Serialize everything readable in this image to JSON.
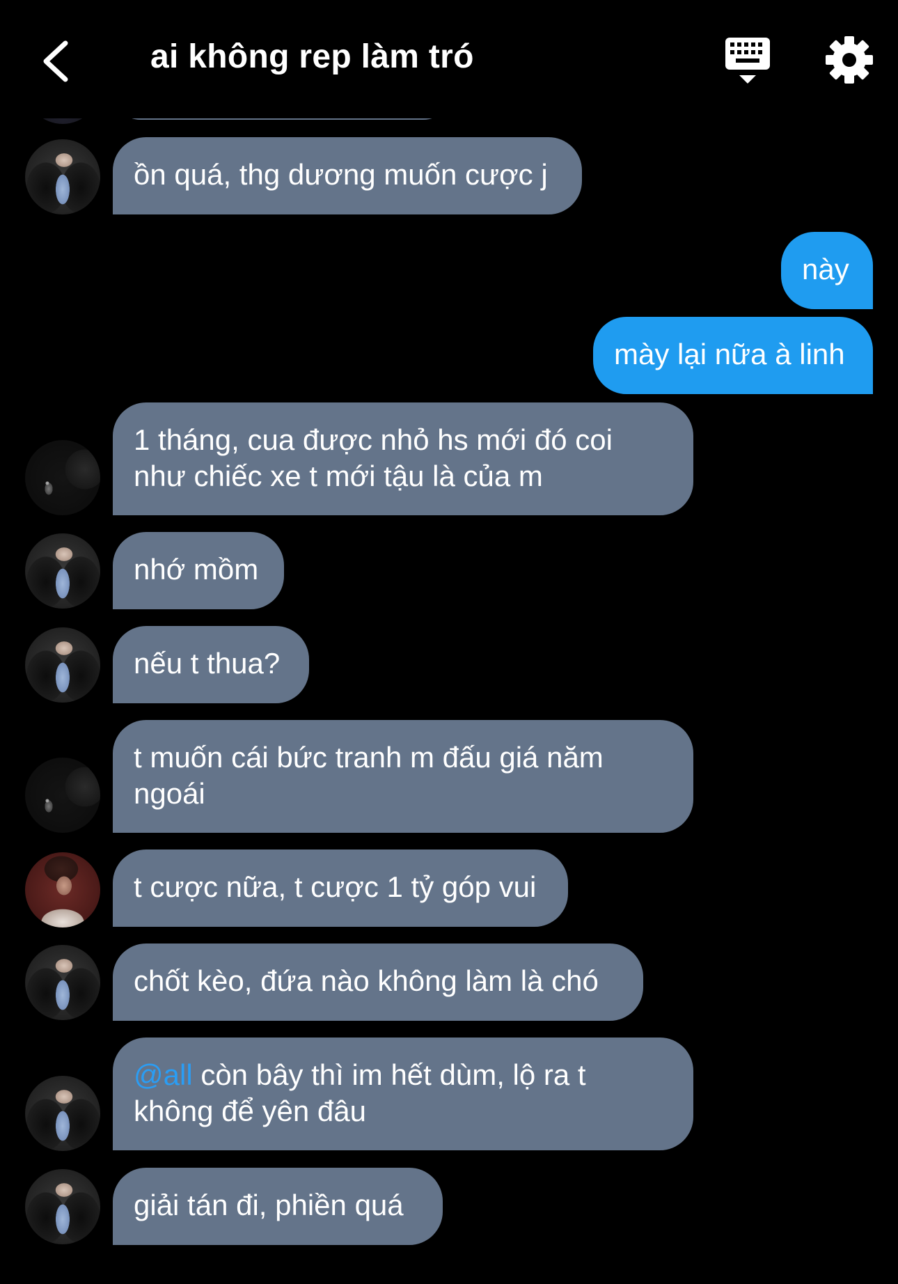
{
  "header": {
    "title": "ai không rep làm tró",
    "back_icon": "chevron-left-icon",
    "keyboard_icon": "keyboard-icon",
    "settings_icon": "gear-icon"
  },
  "colors": {
    "background": "#000000",
    "incoming_bubble": "#64748a",
    "outgoing_bubble": "#1f9cf0",
    "mention": "#2a9df4"
  },
  "messages": [
    {
      "direction": "in",
      "avatar": "girl",
      "lines": [
        "ồn quá, thg dương muốn cược j"
      ]
    },
    {
      "direction": "out",
      "lines": [
        "này"
      ]
    },
    {
      "direction": "out",
      "lines": [
        "mày lại nữa à linh"
      ]
    },
    {
      "direction": "in",
      "avatar": "dark",
      "lines": [
        "1 tháng, cua được nhỏ hs mới đó coi",
        "như chiếc xe t mới tậu là của m"
      ]
    },
    {
      "direction": "in",
      "avatar": "girl",
      "lines": [
        "nhớ mồm"
      ]
    },
    {
      "direction": "in",
      "avatar": "girl",
      "lines": [
        "nếu t thua?"
      ]
    },
    {
      "direction": "in",
      "avatar": "dark",
      "lines": [
        "t muốn cái bức tranh m đấu giá năm",
        "ngoái"
      ]
    },
    {
      "direction": "in",
      "avatar": "boy",
      "lines": [
        "t cược nữa, t cược 1 tỷ góp vui"
      ]
    },
    {
      "direction": "in",
      "avatar": "girl",
      "lines": [
        "chốt kèo, đứa nào không làm là chó"
      ]
    },
    {
      "direction": "in",
      "avatar": "girl",
      "mention": "@all",
      "lines": [
        " còn bây thì im hết dùm, lộ ra t",
        "không để yên đâu"
      ]
    },
    {
      "direction": "in",
      "avatar": "girl",
      "lines": [
        "giải tán đi, phiền quá"
      ]
    }
  ]
}
